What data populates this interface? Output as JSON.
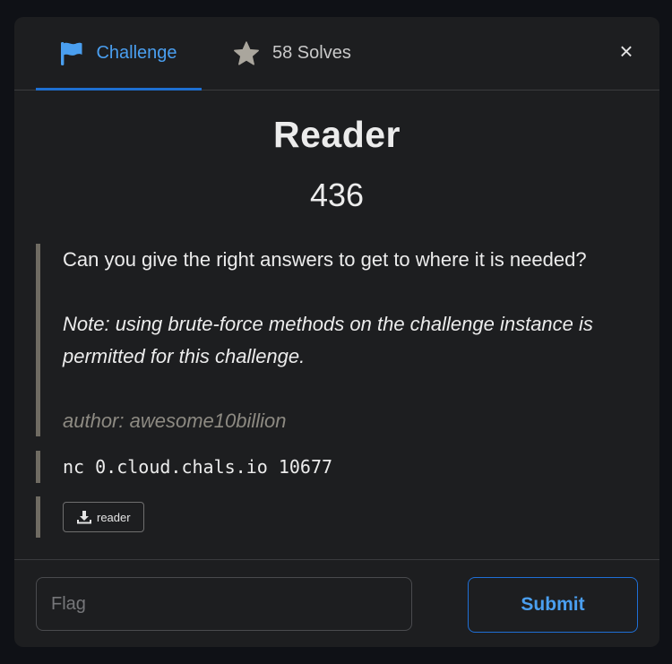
{
  "tabs": [
    {
      "label": "Challenge",
      "icon": "flag-icon",
      "active": true
    },
    {
      "label": "58 Solves",
      "icon": "star-icon",
      "active": false
    }
  ],
  "close_label": "×",
  "challenge": {
    "name": "Reader",
    "points": "436",
    "description": "Can you give the right answers to get to where it is needed?",
    "note": "Note: using brute-force methods on the challenge instance is permitted for this challenge.",
    "author": "author: awesome10billion",
    "connection": "nc 0.cloud.chals.io 10677",
    "files": [
      {
        "label": "reader",
        "icon": "download-icon"
      }
    ]
  },
  "form": {
    "flag_placeholder": "Flag",
    "flag_value": "",
    "submit_label": "Submit"
  },
  "colors": {
    "accent": "#4a9ff0",
    "accent_border": "#1e6fd1",
    "modal_bg": "#1d1e20",
    "page_bg": "#0f1116",
    "quote_bar": "#6f6b62"
  }
}
